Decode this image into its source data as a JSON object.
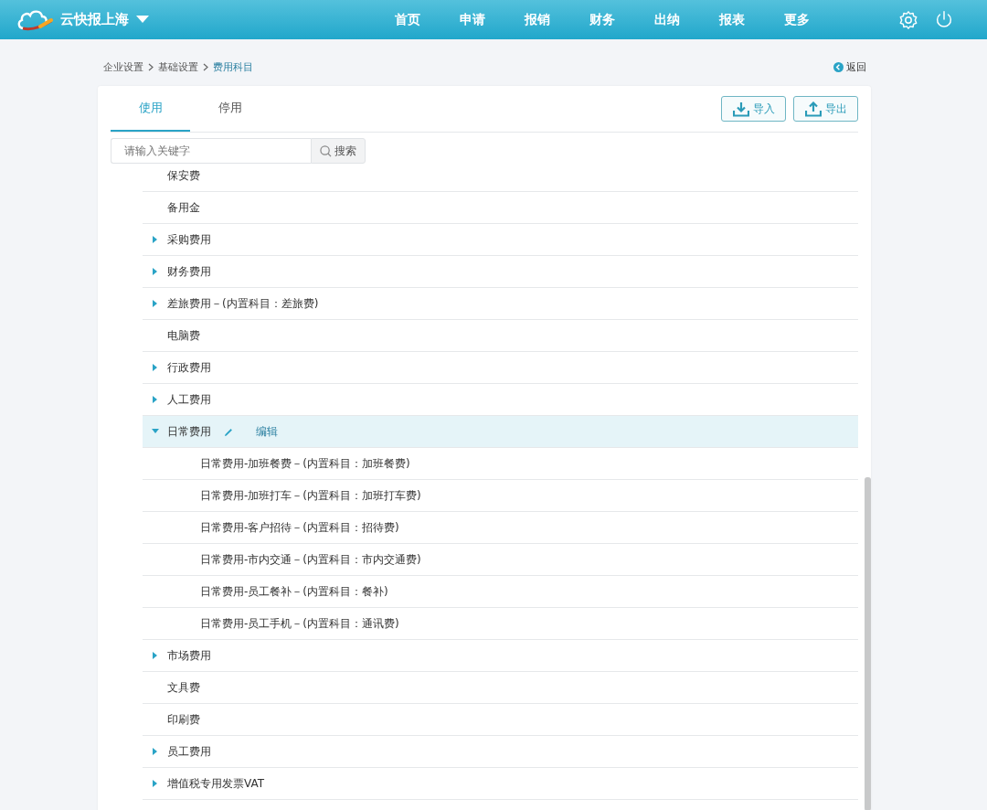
{
  "header": {
    "brand": "云快报上海",
    "nav": [
      {
        "label": "首页",
        "selected": false
      },
      {
        "label": "申请",
        "selected": false
      },
      {
        "label": "报销",
        "selected": false
      },
      {
        "label": "财务",
        "selected": false
      },
      {
        "label": "出纳",
        "selected": false
      },
      {
        "label": "报表",
        "selected": false
      },
      {
        "label": "更多",
        "selected": false
      }
    ]
  },
  "breadcrumb": [
    "企业设置",
    "基础设置",
    "费用科目"
  ],
  "back_link": "返回",
  "tabs": [
    {
      "label": "使用",
      "selected": true
    },
    {
      "label": "停用",
      "selected": false
    }
  ],
  "buttons": [
    {
      "kind": "import",
      "label": "导入"
    },
    {
      "kind": "export",
      "label": "导出"
    }
  ],
  "search": {
    "placeholder": "请输入关键字",
    "button": "搜索"
  },
  "tree": [
    {
      "label": "保安费",
      "selected": false
    },
    {
      "label": "备用金",
      "selected": false
    },
    {
      "label": "采购费用",
      "selected": false,
      "expanded": false
    },
    {
      "label": "财务费用",
      "selected": false,
      "expanded": false
    },
    {
      "label": "差旅费用－(内置科目：差旅费)",
      "selected": false,
      "expanded": false
    },
    {
      "label": "电脑费",
      "selected": false
    },
    {
      "label": "行政费用",
      "selected": false,
      "expanded": false
    },
    {
      "label": "人工费用",
      "selected": false,
      "expanded": false
    },
    {
      "label": "日常费用",
      "selected": true,
      "expanded": true,
      "edit_label": "编辑",
      "children": [
        {
          "label": "日常费用-加班餐费－(内置科目：加班餐费)",
          "selected": false
        },
        {
          "label": "日常费用-加班打车－(内置科目：加班打车费)",
          "selected": false
        },
        {
          "label": "日常费用-客户招待－(内置科目：招待费)",
          "selected": false
        },
        {
          "label": "日常费用-市内交通－(内置科目：市内交通费)",
          "selected": false
        },
        {
          "label": "日常费用-员工餐补－(内置科目：餐补)",
          "selected": false
        },
        {
          "label": "日常费用-员工手机－(内置科目：通讯费)",
          "selected": false
        }
      ]
    },
    {
      "label": "市场费用",
      "selected": false,
      "expanded": false
    },
    {
      "label": "文具费",
      "selected": false
    },
    {
      "label": "印刷费",
      "selected": false
    },
    {
      "label": "员工费用",
      "selected": false,
      "expanded": false
    },
    {
      "label": "增值税专用发票VAT",
      "selected": false,
      "expanded": false
    }
  ]
}
